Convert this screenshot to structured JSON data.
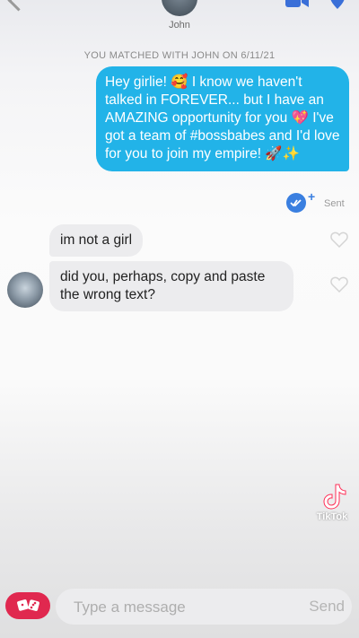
{
  "header": {
    "name": "John",
    "back_icon": "chevron-left-icon",
    "video_icon": "video-camera-icon",
    "safety_icon": "shield-icon"
  },
  "match_notice": "YOU MATCHED WITH JOHN ON 6/11/21",
  "messages": [
    {
      "direction": "outgoing",
      "text": "Hey girlie! 🥰 I know we haven't talked in FOREVER... but I have an AMAZING opportunity for you 💖 I've got a team of #bossbabes and I'd love for you to join my empire! 🚀✨",
      "status": "Sent"
    },
    {
      "direction": "incoming",
      "text": "im not a girl"
    },
    {
      "direction": "incoming",
      "text": "did you, perhaps, copy and paste the wrong text?"
    }
  ],
  "watermark": {
    "brand": "TikTok",
    "icon": "tiktok-logo-icon"
  },
  "composer": {
    "placeholder": "Type a message",
    "send_label": "Send",
    "gif_icon": "dice-icon"
  },
  "colors": {
    "outgoing_bubble": "#22b3e8",
    "incoming_bubble": "#ececee",
    "accent_blue": "#3a7fe0",
    "gif_button": "#e0284f"
  }
}
